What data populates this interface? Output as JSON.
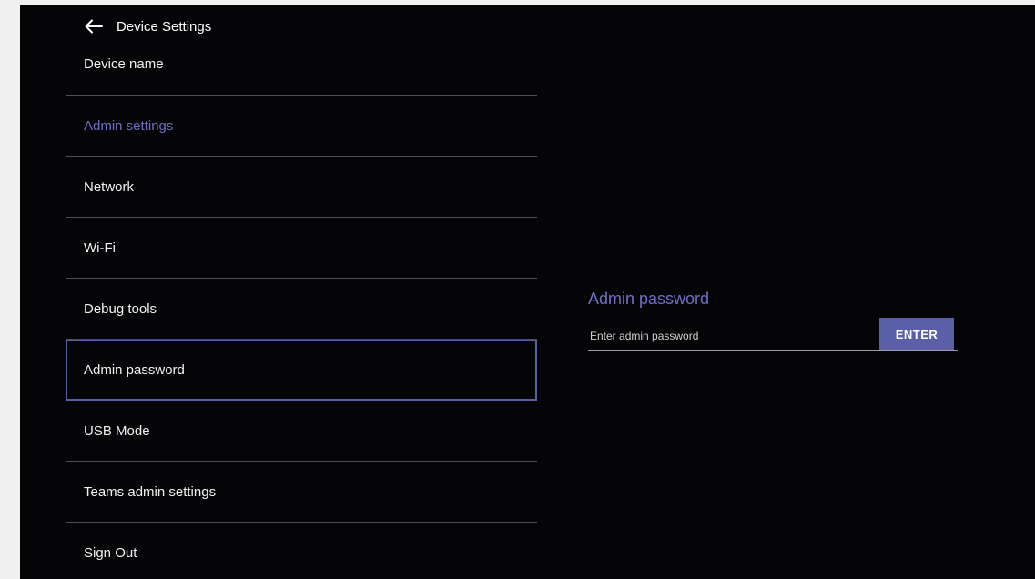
{
  "header": {
    "title": "Device Settings",
    "back_icon": "arrow-left-icon"
  },
  "menu": {
    "items": [
      {
        "label": "Device name"
      },
      {
        "label": "Admin settings",
        "state": "section-heading"
      },
      {
        "label": "Network"
      },
      {
        "label": "Wi-Fi"
      },
      {
        "label": "Debug tools"
      },
      {
        "label": "Admin password",
        "state": "selected"
      },
      {
        "label": "USB Mode"
      },
      {
        "label": "Teams admin settings"
      },
      {
        "label": "Sign Out"
      }
    ]
  },
  "panel": {
    "title": "Admin password",
    "input_placeholder": "Enter admin password",
    "input_value": "",
    "enter_label": "ENTER"
  },
  "colors": {
    "background": "#050507",
    "accent": "#6f70c6",
    "button": "#5b5fa8",
    "text": "#f2f2f2",
    "divider": "#4d4d55"
  }
}
